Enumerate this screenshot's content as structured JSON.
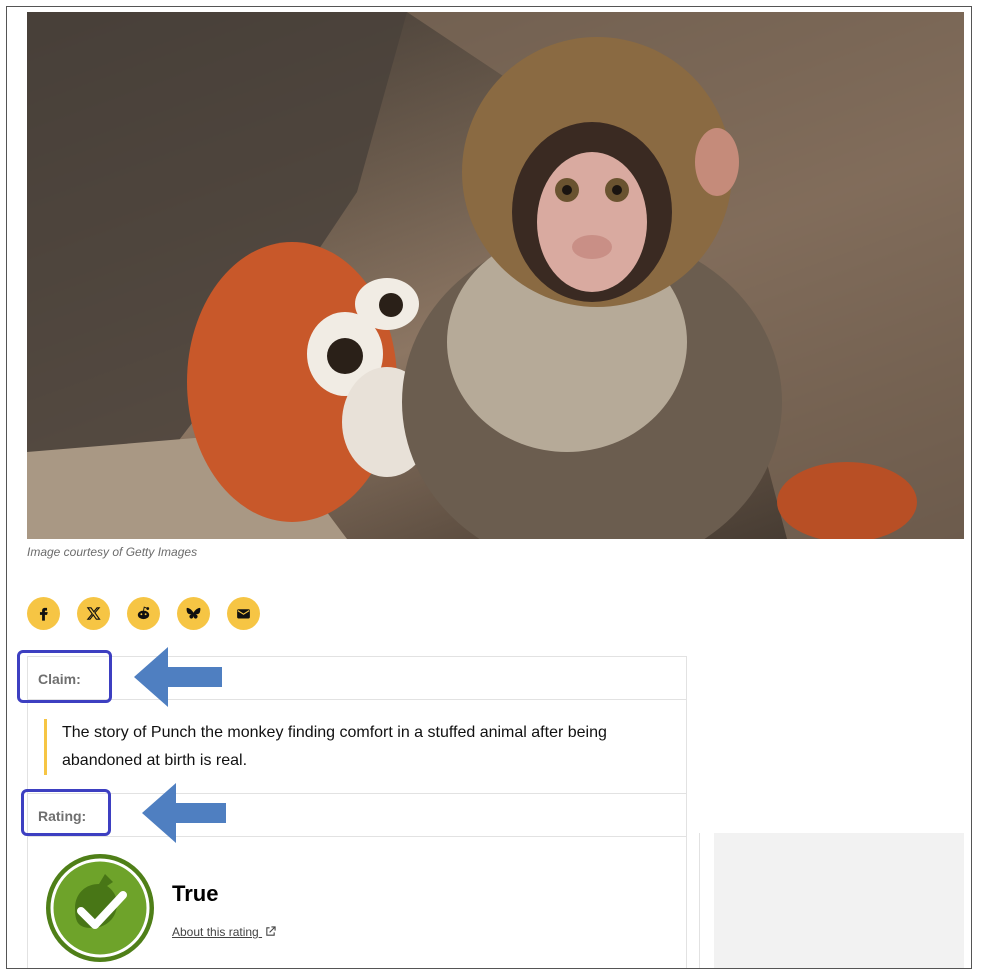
{
  "hero": {
    "image": "monkey-with-stuffed-orangutan-photo",
    "caption": "Image courtesy of Getty Images"
  },
  "share": {
    "icons": [
      "facebook-icon",
      "x-icon",
      "reddit-icon",
      "bluesky-icon",
      "email-icon"
    ],
    "accent": "#f6c544"
  },
  "claim": {
    "label": "Claim:",
    "text": "The story of Punch the monkey finding comfort in a stuffed animal after being abandoned at birth is real."
  },
  "rating": {
    "label": "Rating:",
    "value": "True",
    "about_link": "About this rating",
    "badge_color": "#5a8a1e"
  },
  "annotations": {
    "highlight_color": "#3d3fc1",
    "arrow_color": "#4f7fc1"
  }
}
